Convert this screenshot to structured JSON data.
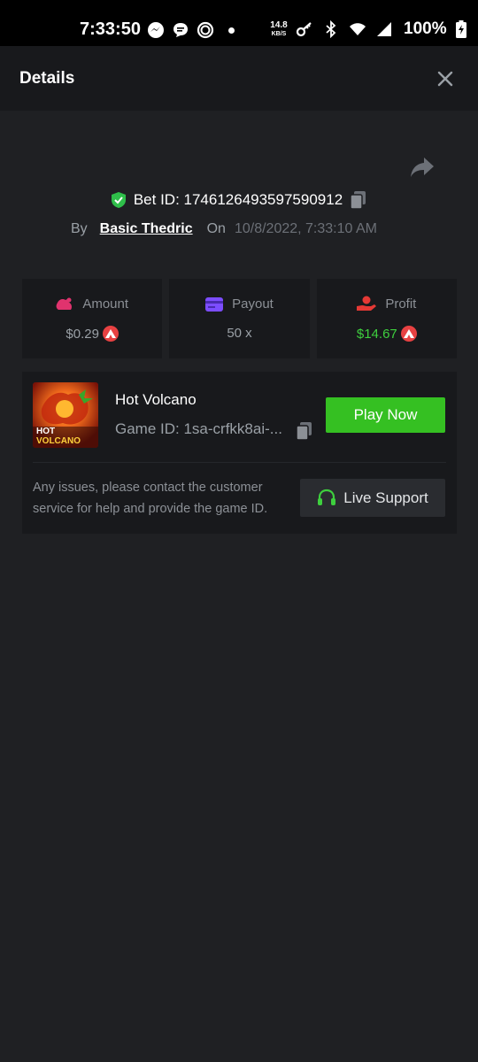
{
  "status_bar": {
    "time": "7:33:50",
    "speed_value": "14.8",
    "speed_unit": "KB/S",
    "battery": "100%"
  },
  "header": {
    "title": "Details"
  },
  "bet": {
    "id_label": "Bet ID: 1746126493597590912",
    "by_label": "By",
    "user": "Basic Thedric",
    "on_label": "On",
    "date": "10/8/2022, 7:33:10 AM"
  },
  "stats": [
    {
      "label": "Amount",
      "value": "$0.29",
      "has_coin": true,
      "color": "#9aa0a6"
    },
    {
      "label": "Payout",
      "value": "50 x",
      "has_coin": false,
      "color": "#9aa0a6"
    },
    {
      "label": "Profit",
      "value": "$14.67",
      "has_coin": true,
      "color": "#3ecf3e"
    }
  ],
  "game": {
    "name": "Hot Volcano",
    "id_text": "Game ID: 1sa-crfkk8ai-...",
    "play_label": "Play Now",
    "thumb_title_1": "HOT",
    "thumb_title_2": "VOLCANO"
  },
  "support": {
    "text": "Any issues, please contact the customer service for help and provide the game ID.",
    "button_label": "Live Support"
  },
  "colors": {
    "accent_green": "#35c022",
    "profit_green": "#3ecf3e",
    "coin_red": "#e84142",
    "amount_pink": "#e0336e",
    "payout_purple": "#7c4dff",
    "profit_red": "#e53935"
  }
}
